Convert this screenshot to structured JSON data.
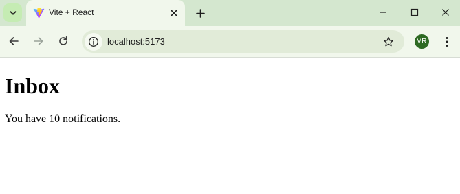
{
  "browser": {
    "tab": {
      "title": "Vite + React",
      "favicon": "vite-logo-icon"
    },
    "address_bar": {
      "url": "localhost:5173"
    },
    "profile": {
      "initials": "VR",
      "color": "#2e6a23"
    },
    "icons": {
      "tab_search": "chevron-down-icon",
      "tab_close": "close-icon",
      "new_tab": "plus-icon",
      "minimize": "minimize-icon",
      "maximize": "maximize-icon",
      "window_close": "close-icon",
      "back": "arrow-left-icon",
      "forward": "arrow-right-icon",
      "reload": "reload-icon",
      "site_info": "info-icon",
      "bookmark": "star-icon",
      "menu": "kebab-menu-icon"
    },
    "colors": {
      "tab_strip": "#d4e7cf",
      "toolbar": "#f1f7ec",
      "omnibox": "#e1ebd8"
    }
  },
  "page": {
    "heading": "Inbox",
    "message": "You have 10 notifications."
  }
}
